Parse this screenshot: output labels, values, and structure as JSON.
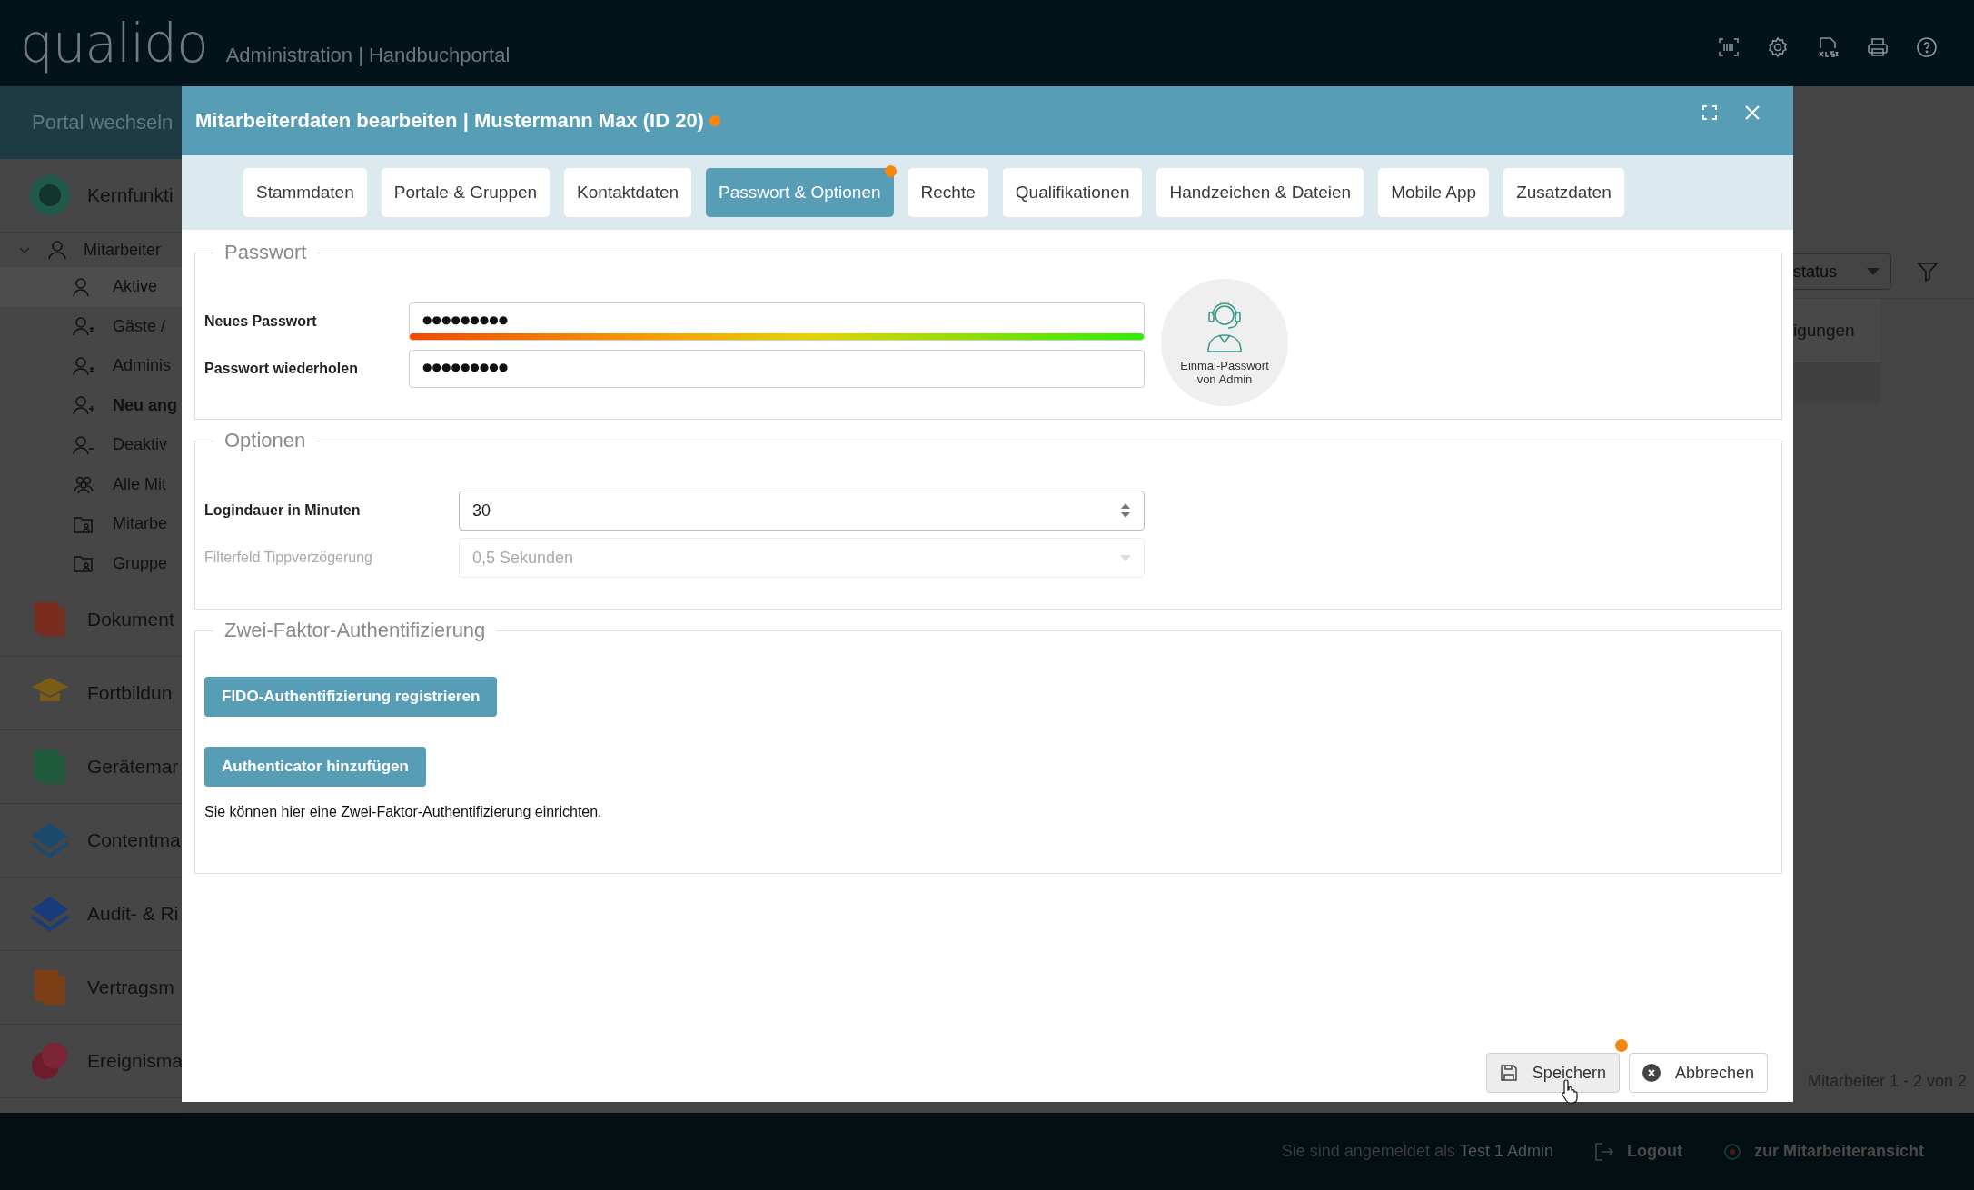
{
  "app": {
    "logo": "qualido",
    "subtitle": "Administration | Handbuchportal"
  },
  "sidebar": {
    "portal_switch": "Portal wechseln",
    "modules": [
      {
        "label": "Kernfunkti",
        "children": [
          {
            "label": "Mitarbeiter",
            "expanded": true,
            "children": [
              {
                "label": "Aktive",
                "selected": true,
                "emphasized": false
              },
              {
                "label": "Gäste /",
                "selected": false,
                "emphasized": false
              },
              {
                "label": "Adminis",
                "selected": false,
                "emphasized": false
              },
              {
                "label": "Neu ang",
                "selected": false,
                "emphasized": true
              },
              {
                "label": "Deaktiv",
                "selected": false,
                "emphasized": false
              },
              {
                "label": "Alle Mit",
                "selected": false,
                "emphasized": false
              },
              {
                "label": "Mitarbe",
                "selected": false,
                "emphasized": false
              },
              {
                "label": "Gruppe",
                "selected": false,
                "emphasized": false
              }
            ]
          }
        ]
      },
      {
        "label": "Dokument"
      },
      {
        "label": "Fortbildun"
      },
      {
        "label": "Gerätemar"
      },
      {
        "label": "Contentma"
      },
      {
        "label": "Audit- & Ri"
      },
      {
        "label": "Vertragsm"
      },
      {
        "label": "Ereignisma"
      }
    ]
  },
  "background": {
    "filter_dropdown": "status",
    "table_row": "igungen",
    "pager": "Mitarbeiter 1 - 2 von 2"
  },
  "modal": {
    "title": "Mitarbeiterdaten bearbeiten | Mustermann Max (ID 20)",
    "modified": true,
    "tabs": [
      {
        "label": "Stammdaten",
        "selected": false,
        "modified": false
      },
      {
        "label": "Portale & Gruppen",
        "selected": false,
        "modified": false
      },
      {
        "label": "Kontaktdaten",
        "selected": false,
        "modified": false
      },
      {
        "label": "Passwort & Optionen",
        "selected": true,
        "modified": true
      },
      {
        "label": "Rechte",
        "selected": false,
        "modified": false
      },
      {
        "label": "Qualifikationen",
        "selected": false,
        "modified": false
      },
      {
        "label": "Handzeichen & Dateien",
        "selected": false,
        "modified": false
      },
      {
        "label": "Mobile App",
        "selected": false,
        "modified": false
      },
      {
        "label": "Zusatzdaten",
        "selected": false,
        "modified": false
      }
    ],
    "password": {
      "legend": "Passwort",
      "fields": [
        {
          "label": "Neues Passwort",
          "value": "●●●●●●●●●"
        },
        {
          "label": "Passwort wiederholen",
          "value": "●●●●●●●●●"
        }
      ],
      "strength": {
        "level": 1
      },
      "one_time_button": {
        "line_1": "Einmal-Passwort",
        "line_2": "von Admin"
      }
    },
    "options": {
      "legend": "Optionen",
      "fields": [
        {
          "kind": "number",
          "label": "Logindauer in Minuten",
          "value": "30",
          "disabled": false
        },
        {
          "kind": "select",
          "label": "Filterfeld Tippverzögerung",
          "value": "0,5 Sekunden",
          "disabled": true
        }
      ]
    },
    "two_factor": {
      "legend": "Zwei-Faktor-Authentifizierung",
      "buttons": [
        "FIDO-Authentifizierung registrieren",
        "Authenticator hinzufügen"
      ],
      "note": "Sie können hier eine Zwei-Faktor-Authentifizierung einrichten."
    },
    "save_button": {
      "label": "Speichern",
      "modified": true,
      "hovered": true
    },
    "cancel_button": {
      "label": "Abbrechen"
    }
  },
  "footer": {
    "login_text": "Sie sind angemeldet als **Test 1 Admin**",
    "logout": "Logout",
    "employee_view": "zur Mitarbeiteransicht"
  }
}
